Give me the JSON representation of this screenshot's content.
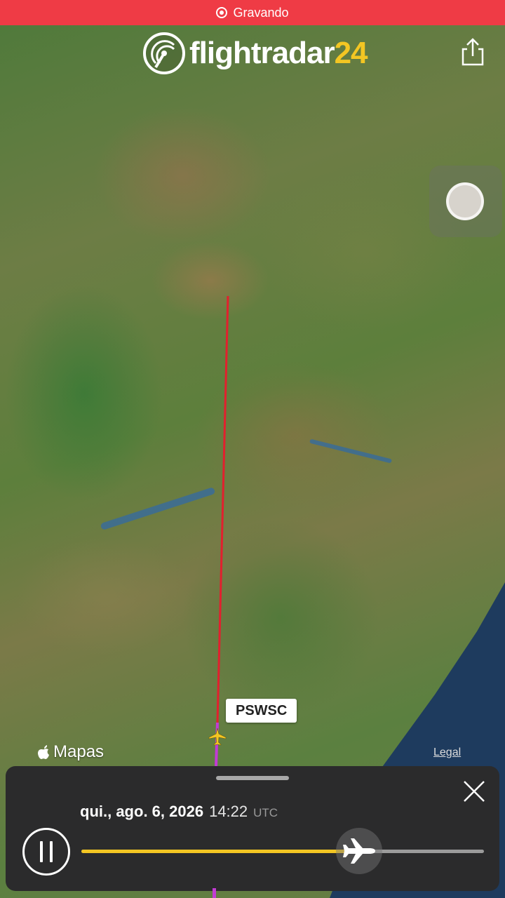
{
  "status_bar": {
    "recording_label": "Gravando"
  },
  "header": {
    "logo_text_main": "flightradar",
    "logo_text_accent": "24",
    "share_icon": "share-icon"
  },
  "map": {
    "provider_label": "Mapas",
    "legal_label": "Legal"
  },
  "flight": {
    "callsign": "PSWSC",
    "path_color": "#e2202e",
    "tail_color": "#c23bd4"
  },
  "playback": {
    "date": "qui., ago. 6, 2026",
    "time": "14:22",
    "timezone": "UTC",
    "progress": 0.69,
    "accent_color": "#f3c623"
  }
}
